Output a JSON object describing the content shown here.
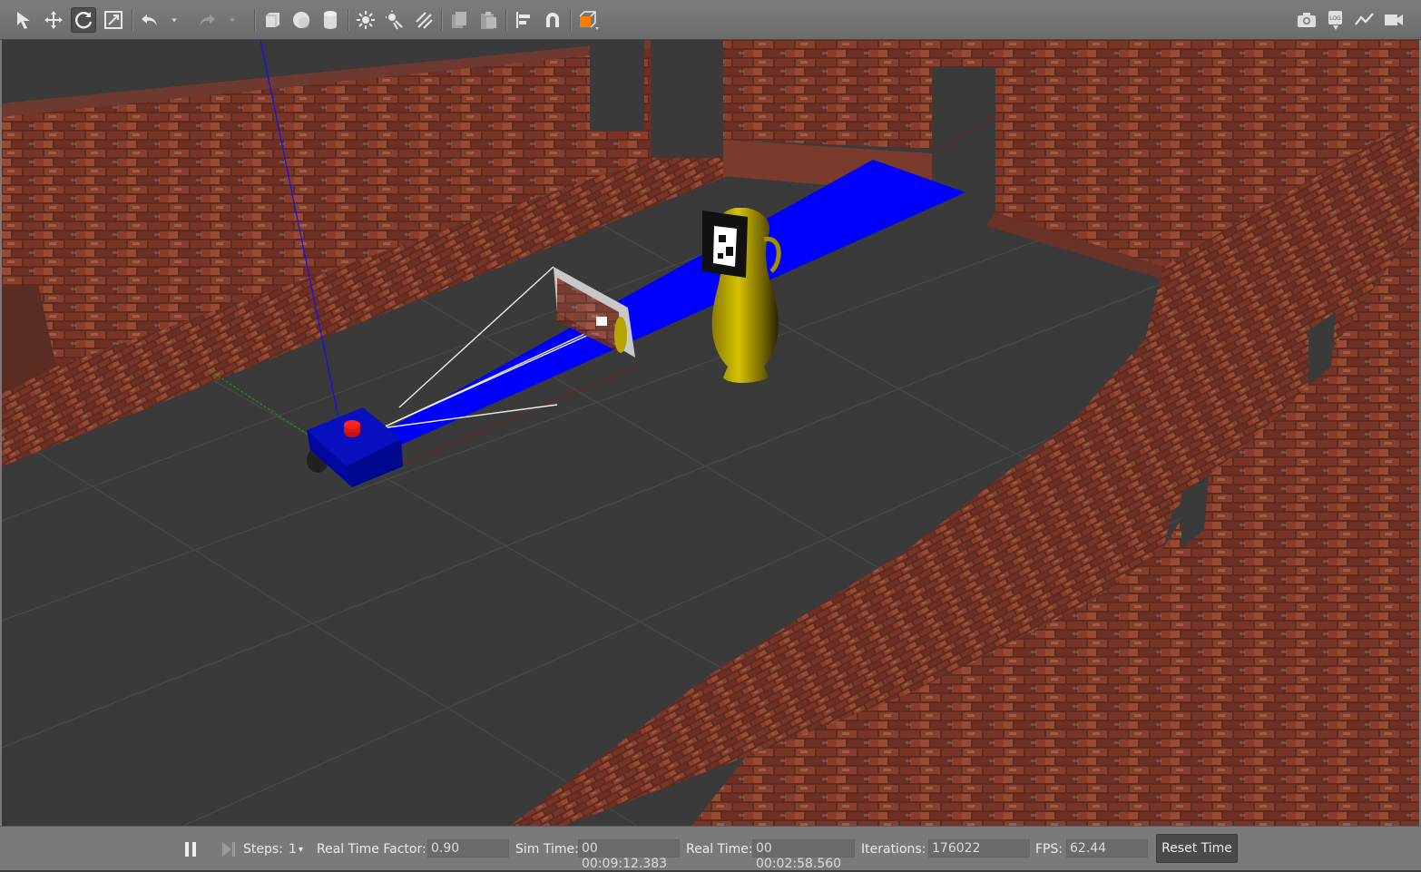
{
  "toolbar": {
    "tools": [
      "select-arrow",
      "translate",
      "rotate",
      "scale",
      "undo",
      "undo-history",
      "redo",
      "redo-history",
      "box",
      "sphere",
      "cylinder",
      "point-light",
      "spot-light",
      "directional-light",
      "copy",
      "paste",
      "align",
      "snap",
      "view-angle"
    ],
    "right_tools": [
      "screenshot",
      "log",
      "plot",
      "video-record"
    ],
    "active_tool": "rotate",
    "accent_color": "#ff7a00"
  },
  "scene": {
    "floor_color": "#3a3a3a",
    "grid_color": "#505050",
    "wall_color": "#8a3a2a",
    "robot_color": "#0008c8",
    "laser_color": "#0000ff",
    "vase_color": "#b8a400"
  },
  "statusbar": {
    "steps_label": "Steps:",
    "steps_value": "1",
    "rtf_label": "Real Time Factor:",
    "rtf_value": "0.90",
    "sim_time_label": "Sim Time:",
    "sim_time_value": "00 00:09:12.383",
    "real_time_label": "Real Time:",
    "real_time_value": "00 00:02:58.560",
    "iterations_label": "Iterations:",
    "iterations_value": "176022",
    "fps_label": "FPS:",
    "fps_value": "62.44",
    "reset_label": "Reset Time"
  }
}
